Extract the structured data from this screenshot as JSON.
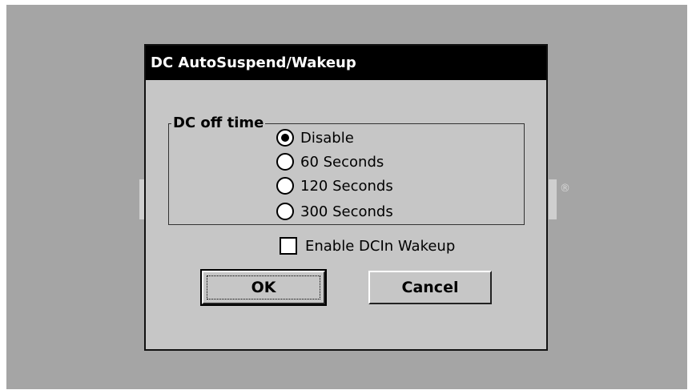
{
  "dialog": {
    "title": "DC AutoSuspend/Wakeup",
    "group_label": "DC off time",
    "options": [
      {
        "label": "Disable",
        "selected": true
      },
      {
        "label": "60 Seconds",
        "selected": false
      },
      {
        "label": "120 Seconds",
        "selected": false
      },
      {
        "label": "300 Seconds",
        "selected": false
      }
    ],
    "wakeup_checkbox": {
      "label": "Enable DCIn Wakeup",
      "checked": false
    },
    "ok_label": "OK",
    "cancel_label": "Cancel"
  },
  "background": {
    "registered_mark": "®"
  },
  "colors": {
    "desktop": "#a5a5a5",
    "dialog_face": "#c6c6c6",
    "titlebar": "#000000",
    "title_text": "#ffffff"
  }
}
